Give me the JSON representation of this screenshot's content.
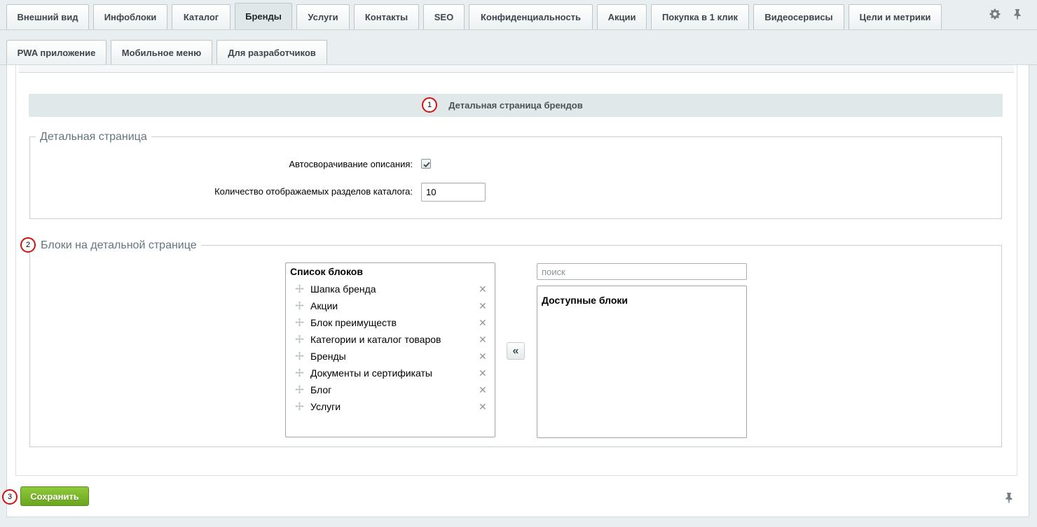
{
  "tabs_row1": [
    {
      "label": "Внешний вид"
    },
    {
      "label": "Инфоблоки"
    },
    {
      "label": "Каталог"
    },
    {
      "label": "Бренды",
      "active": true
    },
    {
      "label": "Услуги"
    },
    {
      "label": "Контакты"
    },
    {
      "label": "SEO"
    },
    {
      "label": "Конфиденциальность"
    },
    {
      "label": "Акции"
    },
    {
      "label": "Покупка в 1 клик"
    },
    {
      "label": "Видеосервисы"
    },
    {
      "label": "Цели и метрики"
    }
  ],
  "tabs_row2": [
    {
      "label": "PWA приложение"
    },
    {
      "label": "Мобильное меню"
    },
    {
      "label": "Для разработчиков"
    }
  ],
  "toolbar_icons": [
    "gear-icon",
    "pin-icon"
  ],
  "section": {
    "title": "Детальная страница брендов",
    "badge": "1"
  },
  "detail_group": {
    "legend": "Детальная страница",
    "autocollapse_label": "Автосворачивание описания:",
    "autocollapse_checked": true,
    "sections_count_label": "Количество отображаемых разделов каталога:",
    "sections_count_value": "10"
  },
  "blocks_group": {
    "badge": "2",
    "legend": "Блоки на детальной странице",
    "list_title": "Список блоков",
    "items": [
      "Шапка бренда",
      "Акции",
      "Блок преимуществ",
      "Категории и каталог товаров",
      "Бренды",
      "Документы и сертификаты",
      "Блог",
      "Услуги"
    ],
    "move_button": "«",
    "search_placeholder": "поиск",
    "available_title": "Доступные блоки"
  },
  "footer": {
    "badge": "3",
    "save_label": "Сохранить"
  },
  "colors": {
    "accent_green": "#7ab62c",
    "badge_red": "#d41010",
    "section_bg": "#e0e8ea"
  }
}
